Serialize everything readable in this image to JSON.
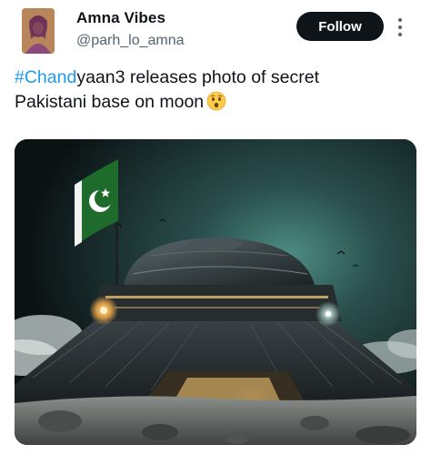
{
  "author": {
    "display_name": "Amna Vibes",
    "handle": "@parh_lo_amna"
  },
  "actions": {
    "follow_label": "Follow"
  },
  "tweet": {
    "hashtag": "#Chand",
    "text_line1": "yaan3 releases photo of secret",
    "text_line2": "Pakistani base on moon",
    "emoji": "astonished-face-emoji"
  },
  "media": {
    "subject": "flying-saucer-base-with-pakistan-flag",
    "colors": {
      "sky_top": "#0b1214",
      "sky_glow": "#3a6f6a",
      "flag_green": "#1f6b2c",
      "flag_white": "#ffffff",
      "ship_metal": "#2c3336",
      "light_amber": "#ffb54a"
    }
  }
}
